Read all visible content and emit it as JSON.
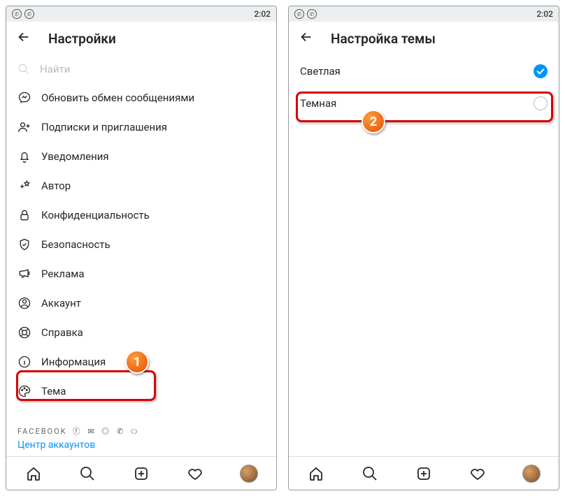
{
  "status": {
    "time": "2:02"
  },
  "left": {
    "title": "Настройки",
    "search_placeholder": "Найти",
    "items": [
      {
        "label": "Обновить обмен сообщениями"
      },
      {
        "label": "Подписки и приглашения"
      },
      {
        "label": "Уведомления"
      },
      {
        "label": "Автор"
      },
      {
        "label": "Конфиденциальность"
      },
      {
        "label": "Безопасность"
      },
      {
        "label": "Реклама"
      },
      {
        "label": "Аккаунт"
      },
      {
        "label": "Справка"
      },
      {
        "label": "Информация"
      },
      {
        "label": "Тема"
      }
    ],
    "brand": "FACEBOOK",
    "accounts_center": "Центр аккаунтов"
  },
  "right": {
    "title": "Настройка темы",
    "options": [
      {
        "label": "Светлая",
        "selected": true
      },
      {
        "label": "Темная",
        "selected": false
      }
    ]
  },
  "annotations": {
    "badge1": "1",
    "badge2": "2"
  }
}
